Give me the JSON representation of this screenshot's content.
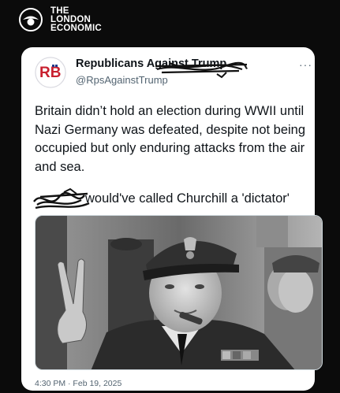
{
  "brand": {
    "line1": "THE",
    "line2": "LONDON",
    "line3": "ECONOMIC"
  },
  "tweet": {
    "display_name": "Republicans Against Trump",
    "avatar_initials": "RB",
    "handle": "@RpsAgainstTrump",
    "body": "Britain didn’t hold an election during WWII until Nazi Germany was defeated, despite not being occupied but only enduring attacks from the air and sea.",
    "second_line": "would've called Churchill a 'dictator'",
    "more_label": "···",
    "timestamp": "4:30 PM · Feb 19, 2025"
  },
  "colors": {
    "background": "#0b0b0b",
    "card": "#ffffff",
    "text": "#0f1419",
    "muted": "#536471",
    "avatar_red": "#c8202f",
    "avatar_blue": "#1e3a8a"
  }
}
